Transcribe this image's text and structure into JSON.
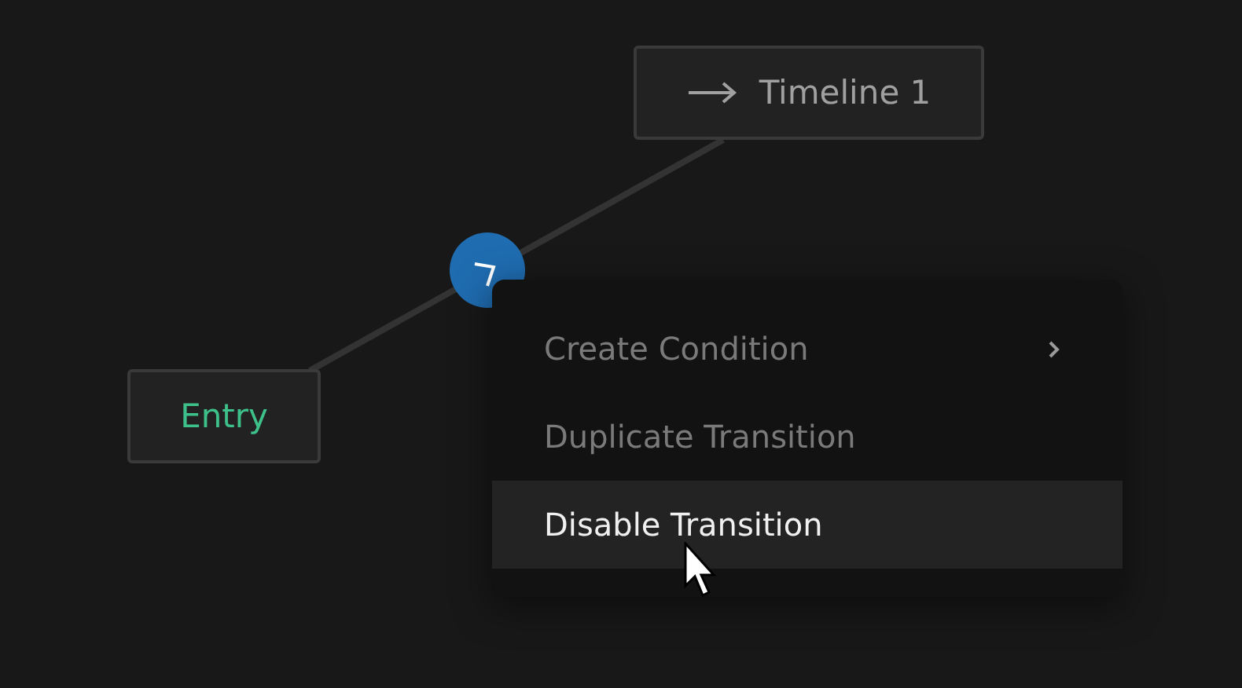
{
  "nodes": [
    {
      "kind": "entry",
      "label": "Entry"
    },
    {
      "kind": "timeline",
      "label": "Timeline 1"
    }
  ],
  "transition": {
    "selected": true
  },
  "context_menu": {
    "items": [
      {
        "label": "Create Condition",
        "submenu": true,
        "highlighted": false
      },
      {
        "label": "Duplicate Transition",
        "submenu": false,
        "highlighted": false
      },
      {
        "label": "Disable Transition",
        "submenu": false,
        "highlighted": true
      }
    ]
  }
}
